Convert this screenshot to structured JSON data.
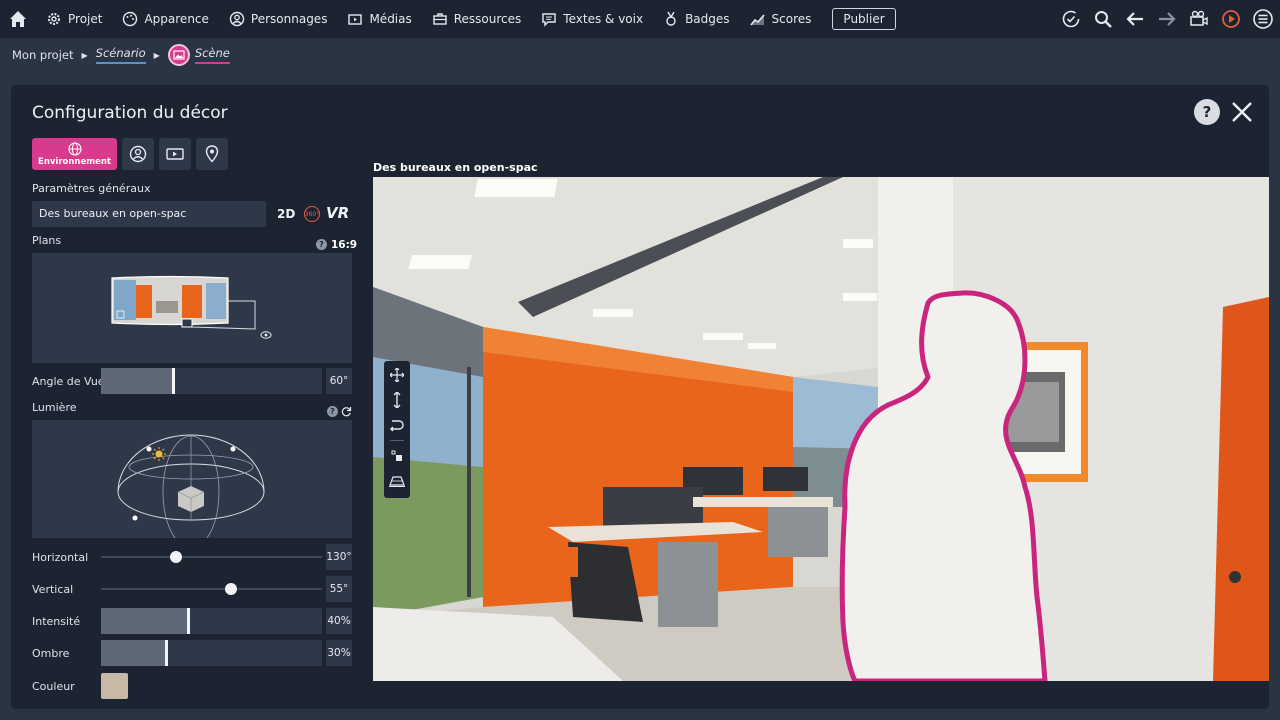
{
  "topnav": {
    "items": [
      {
        "label": "Projet",
        "icon": "gear-icon"
      },
      {
        "label": "Apparence",
        "icon": "palette-icon"
      },
      {
        "label": "Personnages",
        "icon": "person-icon"
      },
      {
        "label": "Médias",
        "icon": "media-icon"
      },
      {
        "label": "Ressources",
        "icon": "briefcase-icon"
      },
      {
        "label": "Textes & voix",
        "icon": "chat-icon"
      },
      {
        "label": "Badges",
        "icon": "medal-icon"
      },
      {
        "label": "Scores",
        "icon": "chart-icon"
      }
    ],
    "publish_label": "Publier"
  },
  "breadcrumb": {
    "project": "Mon projet",
    "scenario": "Scénario",
    "scene": "Scène"
  },
  "panel": {
    "title": "Configuration du décor",
    "help_label": "?",
    "active_tab_label": "Environnement",
    "general_label": "Paramètres généraux",
    "scene_name": "Des bureaux en open-spac",
    "mode_2d": "2D",
    "mode_360": "360°",
    "mode_vr": "VR",
    "plans_label": "Plans",
    "ratio": "16:9",
    "angle_label": "Angle de Vue",
    "angle_value": "60°",
    "angle_fraction": 0.33,
    "light_label": "Lumière",
    "horizontal_label": "Horizontal",
    "horizontal_value": "130°",
    "horizontal_fraction": 0.34,
    "vertical_label": "Vertical",
    "vertical_value": "55°",
    "vertical_fraction": 0.59,
    "intensity_label": "Intensité",
    "intensity_value": "40%",
    "intensity_fraction": 0.4,
    "shadow_label": "Ombre",
    "shadow_value": "30%",
    "shadow_fraction": 0.3,
    "color_label": "Couleur",
    "color_value": "#c8b8a6"
  },
  "viewport": {
    "label": "Des bureaux en open-spac"
  },
  "colors": {
    "accent": "#d93a8d",
    "bg": "#2b3443",
    "panel": "#1d2431"
  }
}
